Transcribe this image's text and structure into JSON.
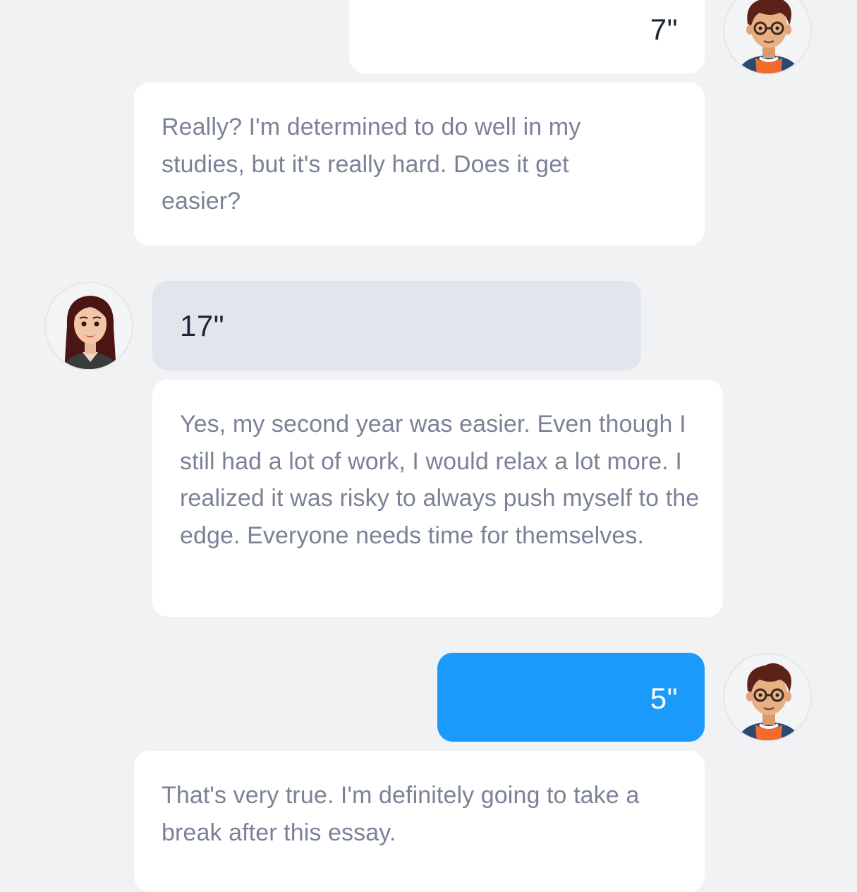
{
  "messages": [
    {
      "sender": "me",
      "kind": "audio",
      "duration": "7\"",
      "active": false
    },
    {
      "sender": "me",
      "kind": "transcript",
      "text": "Really? I'm determined to do well in my studies, but it's really hard. Does it get easier?"
    },
    {
      "sender": "partner",
      "kind": "audio",
      "duration": "17\""
    },
    {
      "sender": "partner",
      "kind": "transcript",
      "text": "Yes, my second year was easier. Even though I still had a lot of work, I would relax a lot more. I realized it was risky to always push myself to the edge. Everyone needs time for themselves."
    },
    {
      "sender": "me",
      "kind": "audio",
      "duration": "5\"",
      "active": true
    },
    {
      "sender": "me",
      "kind": "transcript",
      "text": "That's very true. I'm definitely going to take a break after this essay."
    }
  ],
  "avatars": {
    "me": "boy-glasses-avatar",
    "partner": "woman-long-hair-avatar"
  },
  "colors": {
    "background": "#f1f2f4",
    "bubble_white": "#ffffff",
    "bubble_partner_audio": "#e1e5ec",
    "bubble_active": "#1a9bfb",
    "text_dark": "#1b2537",
    "text_muted": "#7a8396"
  }
}
